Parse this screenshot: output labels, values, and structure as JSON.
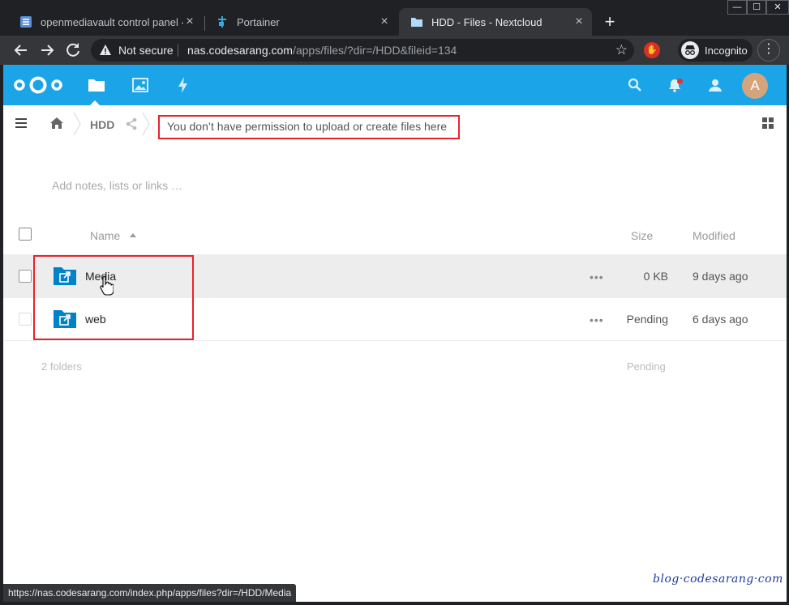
{
  "browser": {
    "tabs": [
      {
        "title": "openmediavault control panel - c",
        "active": false,
        "favicon": "omv-icon"
      },
      {
        "title": "Portainer",
        "active": false,
        "favicon": "portainer-icon"
      },
      {
        "title": "HDD - Files - Nextcloud",
        "active": true,
        "favicon": "folder-icon"
      }
    ],
    "new_tab": "+",
    "window_buttons": {
      "minimize": "—",
      "maximize": "☐",
      "close": "✕"
    },
    "security_label": "Not secure",
    "url_host": "nas.codesarang.com",
    "url_path": "/apps/files/?dir=/HDD&fileid=134",
    "profile_label": "Incognito",
    "status_url": "https://nas.codesarang.com/index.php/apps/files?dir=/HDD/Media"
  },
  "nextcloud": {
    "header_apps": [
      "files-icon",
      "gallery-icon",
      "activity-icon"
    ],
    "header_right": [
      "search-icon",
      "notifications-icon",
      "contacts-icon"
    ],
    "avatar_letter": "A",
    "accent_color": "#1ca4e8",
    "breadcrumb": {
      "current": "HDD",
      "permission_message": "You don’t have permission to upload or create files here"
    },
    "notes_placeholder": "Add notes, lists or links …",
    "table": {
      "columns": {
        "name": "Name",
        "size": "Size",
        "modified": "Modified"
      },
      "sort": "name-ascending",
      "rows": [
        {
          "name": "Media",
          "size": "0 KB",
          "modified": "9 days ago",
          "hovered": true
        },
        {
          "name": "web",
          "size": "Pending",
          "modified": "6 days ago",
          "hovered": false
        }
      ],
      "more_label": "•••",
      "summary": {
        "count": "2 folders",
        "size": "Pending"
      }
    }
  },
  "watermark": "blog·codesarang·com",
  "annotation_color": "#e8232b"
}
